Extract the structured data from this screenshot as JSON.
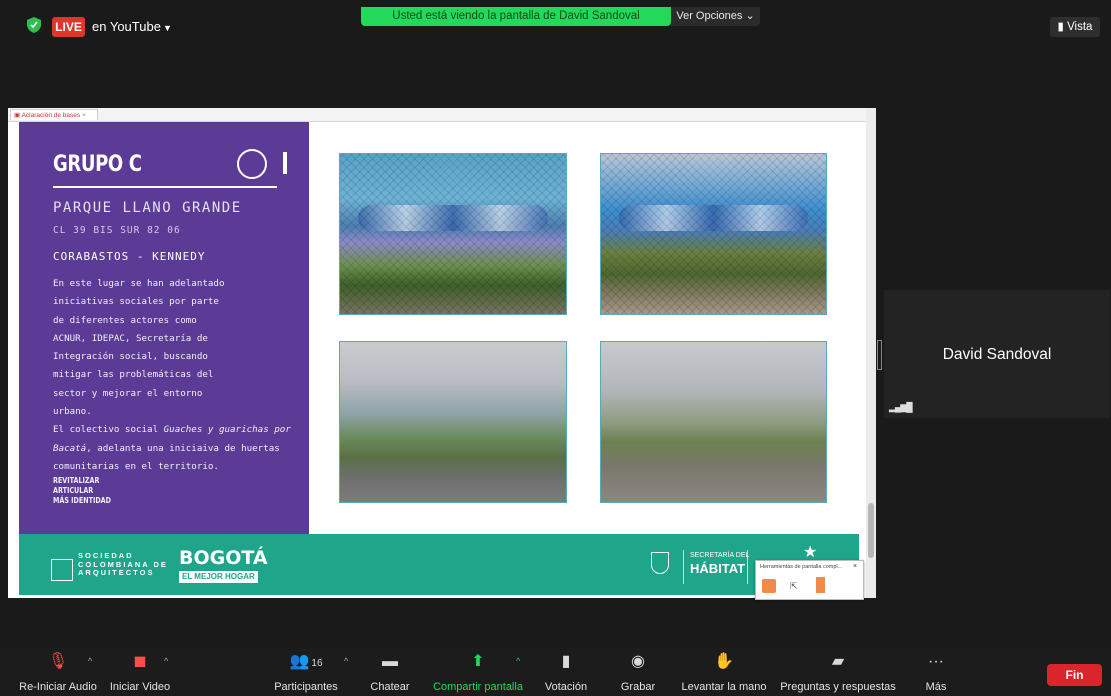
{
  "top_bar": {
    "live_badge": "LIVE",
    "stream_target": "en YouTube",
    "banner": "Usted está viendo la pantalla de David Sandoval",
    "view_options": "Ver Opciones ⌄",
    "view_button": "Vista"
  },
  "browser": {
    "tab_title": "Aclaración de bases"
  },
  "slide": {
    "title": "GRUPO C",
    "park_name": "PARQUE LLANO GRANDE",
    "address": "CL 39 BIS SUR 82 06",
    "locality": "CORABASTOS - KENNEDY",
    "body_lines": [
      "En este lugar se han adelantado",
      "iniciativas sociales por parte",
      "de diferentes actores como",
      "ACNUR, IDEPAC, Secretaría de",
      "Integración social, buscando",
      "mitigar las problemáticas del",
      "sector y mejorar el entorno",
      "urbano."
    ],
    "collective_intro": "El colectivo social ",
    "collective_name": "Guaches y guarichas por Bacatá",
    "collective_rest": ", adelanta una iniciaiva de huertas comunitarias en el territorio.",
    "keywords": [
      "REVITALIZAR",
      "ARTICULAR",
      "MÁS IDENTIDAD"
    ],
    "footer": {
      "sca_lines": [
        "SOCIEDAD",
        "COLOMBIANA DE",
        "ARQUITECTOS"
      ],
      "bogota": "BOGOTÁ",
      "bogota_sub": "EL MEJOR HOGAR",
      "secretaria": "SECRETARÍA DEL",
      "habitat": "HÁBITAT"
    }
  },
  "annotation_toolbar": {
    "title": "Herramientas de pantalla compl...",
    "close": "×"
  },
  "participant": {
    "name": "David Sandoval"
  },
  "toolbar": {
    "items": [
      {
        "icon": "microphone-muted-icon",
        "label": "Re-Iniciar Audio"
      },
      {
        "icon": "video-off-icon",
        "label": "Iniciar Video"
      },
      {
        "icon": "participants-icon",
        "label": "Participantes",
        "count": "16"
      },
      {
        "icon": "chat-icon",
        "label": "Chatear"
      },
      {
        "icon": "share-screen-icon",
        "label": "Compartir pantalla"
      },
      {
        "icon": "poll-icon",
        "label": "Votación"
      },
      {
        "icon": "record-icon",
        "label": "Grabar"
      },
      {
        "icon": "raise-hand-icon",
        "label": "Levantar la mano"
      },
      {
        "icon": "qa-icon",
        "label": "Preguntas y respuestas"
      },
      {
        "icon": "more-icon",
        "label": "Más"
      }
    ],
    "end_button": "Fin"
  },
  "colors": {
    "slide_purple": "#5b3b96",
    "slide_teal": "#1fa58a",
    "banner_green": "#23d959",
    "live_red": "#e0352b",
    "end_red": "#d9252b",
    "share_green": "#23d959"
  }
}
